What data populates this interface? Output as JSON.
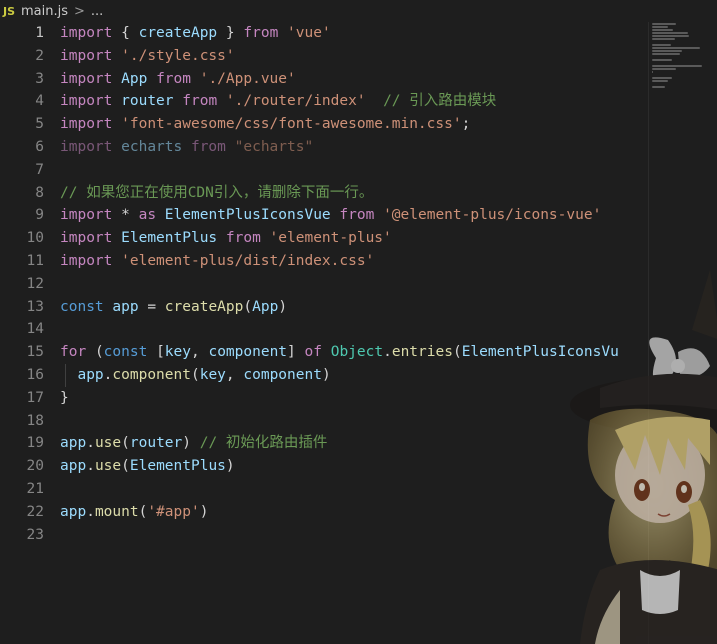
{
  "breadcrumb": {
    "file_badge": "JS",
    "file_name": "main.js",
    "separator": ">",
    "trailing": "..."
  },
  "editor": {
    "language": "javascript",
    "line_numbers": [
      "1",
      "2",
      "3",
      "4",
      "5",
      "6",
      "7",
      "8",
      "9",
      "10",
      "11",
      "12",
      "13",
      "14",
      "15",
      "16",
      "17",
      "18",
      "19",
      "20",
      "21",
      "22",
      "23"
    ],
    "active_line": 1,
    "lines": [
      "import { createApp } from 'vue'",
      "import './style.css'",
      "import App from './App.vue'",
      "import router from './router/index'  // 引入路由模块",
      "import 'font-awesome/css/font-awesome.min.css';",
      "import echarts from \"echarts\"",
      "",
      "// 如果您正在使用CDN引入，请删除下面一行。",
      "import * as ElementPlusIconsVue from '@element-plus/icons-vue'",
      "import ElementPlus from 'element-plus'",
      "import 'element-plus/dist/index.css'",
      "",
      "const app = createApp(App)",
      "",
      "for (const [key, component] of Object.entries(ElementPlusIconsVu",
      "  app.component(key, component)",
      "}",
      "",
      "app.use(router) // 初始化路由插件",
      "app.use(ElementPlus)",
      "",
      "app.mount('#app')",
      ""
    ]
  },
  "colors": {
    "background": "#1e1e1e",
    "keyword": "#c586c0",
    "string": "#ce9178",
    "variable": "#9cdcfe",
    "function": "#dcdcaa",
    "class": "#4ec9b0",
    "comment": "#6a9955",
    "storage": "#569cd6",
    "line_number": "#858585"
  },
  "decorations": {
    "minimap": "minimap",
    "background_character": "anime-witch-character"
  }
}
